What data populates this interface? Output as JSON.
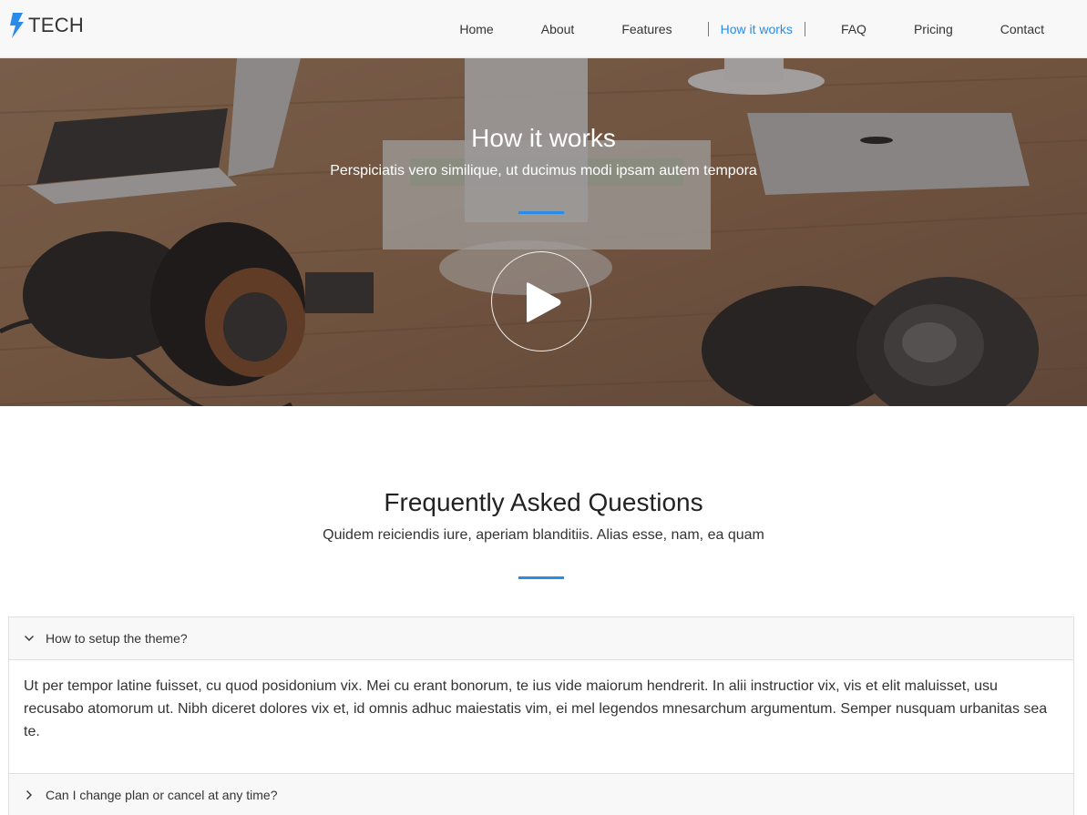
{
  "brand": {
    "name": "TECH",
    "icon": "bolt-icon",
    "color": "#2b8ce8"
  },
  "nav": {
    "items": [
      {
        "label": "Home",
        "active": false
      },
      {
        "label": "About",
        "active": false
      },
      {
        "label": "Features",
        "active": false
      },
      {
        "label": "How it works",
        "active": true
      },
      {
        "label": "FAQ",
        "active": false
      },
      {
        "label": "Pricing",
        "active": false
      },
      {
        "label": "Contact",
        "active": false
      }
    ]
  },
  "hero": {
    "title": "How it works",
    "subtitle": "Perspiciatis vero similique, ut ducimus modi ipsam autem tempora",
    "play_icon": "play-icon"
  },
  "faq": {
    "title": "Frequently Asked Questions",
    "subtitle": "Quidem reiciendis iure, aperiam blanditiis. Alias esse, nam, ea quam",
    "items": [
      {
        "question": "How to setup the theme?",
        "expanded": true,
        "answer": "Ut per tempor latine fuisset, cu quod posidonium vix. Mei cu erant bonorum, te ius vide maiorum hendrerit. In alii instructior vix, vis et elit maluisset, usu recusabo atomorum ut. Nibh diceret dolores vix et, id omnis adhuc maiestatis vim, ei mel legendos mnesarchum argumentum. Semper nusquam urbanitas sea te."
      },
      {
        "question": "Can I change plan or cancel at any time?",
        "expanded": false,
        "answer": ""
      }
    ]
  },
  "colors": {
    "accent": "#2b8ce8",
    "nav_bg": "#f8f8f8"
  }
}
